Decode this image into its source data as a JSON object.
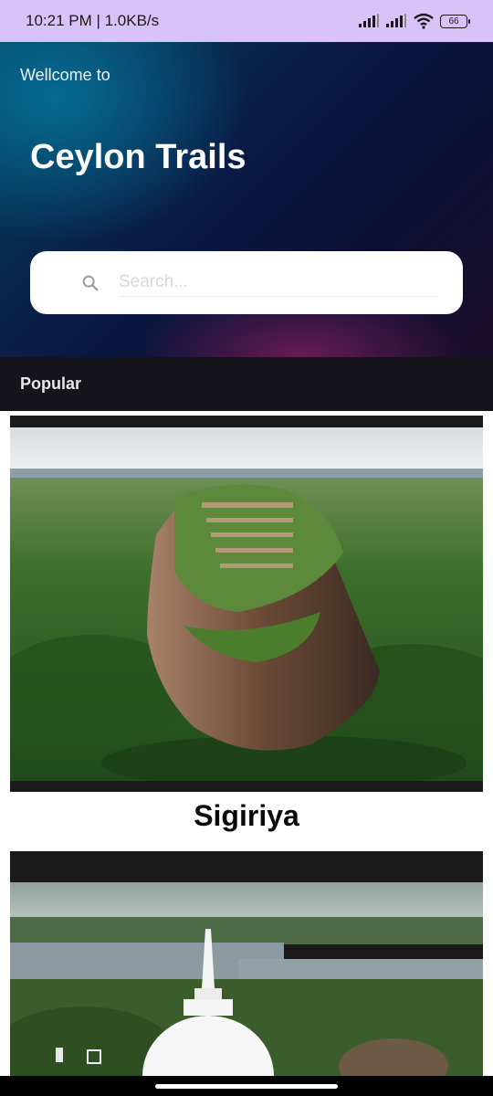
{
  "status_bar": {
    "time_speed": "10:21 PM | 1.0KB/s",
    "battery": "66"
  },
  "header": {
    "welcome": "Wellcome to",
    "title": "Ceylon Trails"
  },
  "search": {
    "placeholder": "Search..."
  },
  "section": {
    "popular": "Popular"
  },
  "places": [
    {
      "name": "Sigiriya"
    },
    {
      "name": ""
    }
  ],
  "colors": {
    "status_bar_bg": "#d9c2f7",
    "section_bar_bg": "#16141b",
    "card_frame_bg": "#1a1a1a"
  }
}
